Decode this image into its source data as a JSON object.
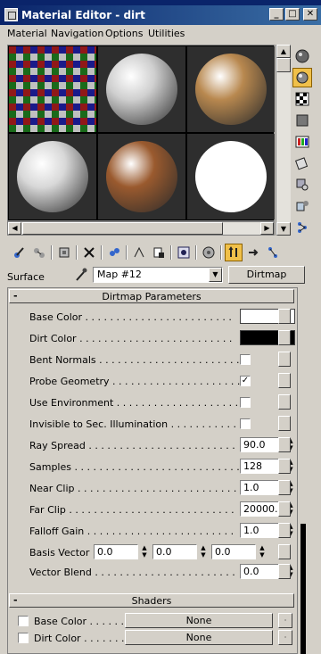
{
  "window": {
    "title": "Material Editor - dirt",
    "minimize": "_",
    "maximize": "□",
    "close": "✕"
  },
  "menu": [
    "Material",
    "Navigation",
    "Options",
    "Utilities"
  ],
  "slots": [
    {
      "type": "checker"
    },
    {
      "type": "sphere",
      "color": "#cfcfcf"
    },
    {
      "type": "sphere",
      "color": "#b8884f"
    },
    {
      "type": "sphere",
      "color": "#d8d8d8"
    },
    {
      "type": "sphere",
      "color": "#9a5a2e"
    },
    {
      "type": "sphere",
      "color": "#ffffff"
    }
  ],
  "surface": {
    "label": "Surface",
    "map_name": "Map #12",
    "map_type": "Dirtmap"
  },
  "rollouts": {
    "dirtmap_title": "Dirtmap Parameters",
    "shaders_title": "Shaders",
    "minus": "-"
  },
  "params": [
    {
      "label": "Base Color . . . . . . . . . . . . . . . . . . . . . . . ."
    },
    {
      "label": "Dirt Color . . . . . . . . . . . . . . . . . . . . . . . . ."
    },
    {
      "label": "Bent Normals . . . . . . . . . . . . . . . . . . . . . . ."
    },
    {
      "label": "Probe Geometry . . . . . . . . . . . . . . . . . . . . ."
    },
    {
      "label": "Use Environment . . . . . . . . . . . . . . . . . . . ."
    },
    {
      "label": "Invisible to Sec. Illumination . . . . . . . . . . ."
    },
    {
      "label": "Ray Spread . . . . . . . . . . . . . . . . . . . . . . . .",
      "value": "90.0"
    },
    {
      "label": "Samples . . . . . . . . . . . . . . . . . . . . . . . . . . .",
      "value": "128"
    },
    {
      "label": "Near Clip . . . . . . . . . . . . . . . . . . . . . . . . . .",
      "value": "1.0"
    },
    {
      "label": "Far Clip . . . . . . . . . . . . . . . . . . . . . . . . . . .",
      "value": "20000.0"
    },
    {
      "label": "Falloff Gain . . . . . . . . . . . . . . . . . . . . . . . .",
      "value": "1.0"
    },
    {
      "label": "Basis Vector . .",
      "v1": "0.0",
      "v2": "0.0",
      "v3": "0.0"
    },
    {
      "label": "Vector Blend . . . . . . . . . . . . . . . . . . . . . . .",
      "value": "0.0"
    }
  ],
  "colors": {
    "base": "#ffffff",
    "dirt": "#000000",
    "accent": "#f0c04a",
    "title_bar": "#0a246a"
  },
  "checkboxes": {
    "bent_normals": false,
    "probe_geometry": true,
    "use_environment": false,
    "invisible": false
  },
  "check_mark": "✓",
  "shaders": [
    {
      "label": "Base Color . . . . . . . .",
      "button": "None",
      "small": "·"
    },
    {
      "label": "Dirt Color . . . . . . . .",
      "button": "None",
      "small": "·"
    }
  ]
}
